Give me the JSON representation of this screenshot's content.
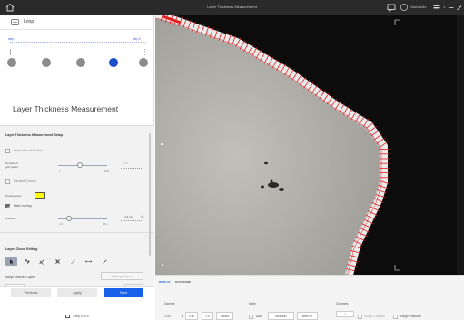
{
  "window": {
    "title": "Layer Thickness Measurement"
  },
  "titlebar": {
    "user_label": "Standards",
    "page_label": "1"
  },
  "loop": {
    "label": "Loop"
  },
  "steps": {
    "first_label": "step 1",
    "last_label": "step 5",
    "total": 5,
    "active_index": 4
  },
  "panel": {
    "title": "Layer Thickness Measurement"
  },
  "setup": {
    "title": "Layer Thickness Measurement Setup",
    "automatic_detection_label": "Automatic detection",
    "grid_points_label_line1": "Number of",
    "grid_points_label_line2": "grid points",
    "grid_points_min": "1",
    "grid_points_max": "100",
    "grid_points_value": "100",
    "grid_points_fraction": 0.45,
    "parallel_chords_label": "Parallel Chords",
    "overlay_color_label": "Overlay color",
    "overlay_color": "#ffff00",
    "hide_overlay_label": "Hide overlay",
    "hide_overlay_checked": true,
    "distance_label": "Distance",
    "distance_min": "1.6",
    "distance_max": "16.1",
    "distance_value": "4.3 µm",
    "distance_fraction": 0.22
  },
  "chord": {
    "title": "Layer/ Chord Editing",
    "merge_selected_label": "Merge Selected Layers",
    "merge_layers_button": "Merge Layers",
    "undo_button": "Undo",
    "redo_button": "Redo"
  },
  "footer": {
    "previous_button": "Previous",
    "apply_button": "Apply",
    "next_button": "Next",
    "step_of": "Step 4 of 5"
  },
  "display": {
    "tab_display": "DISPLAY",
    "tab_data_zone": "DATA ZONE",
    "gamma_label": "Gamma",
    "gamma_value": "1.00",
    "gamma_low": "0.40",
    "gamma_high": "1.0",
    "reset_button": "Reset",
    "mode_label": "Mode",
    "auto_label": "Auto",
    "minmax_button": "Min/Max",
    "bestfit_button": "Best Fit",
    "channels_label": "Channels",
    "channel_value": "1",
    "single_channel_label": "Single Channel",
    "range_indicator_label": "Range Indicator"
  },
  "colors": {
    "accent": "#1760e8",
    "measurement_lines": "#e02020",
    "layer": "#f0f0f0"
  }
}
